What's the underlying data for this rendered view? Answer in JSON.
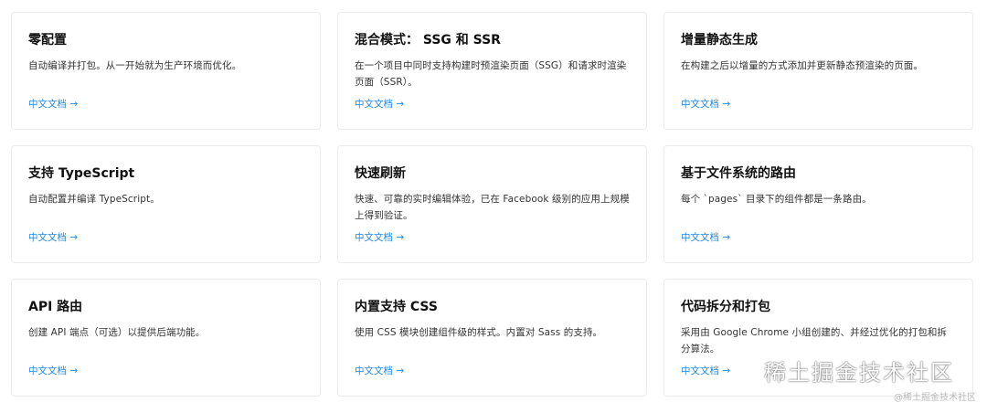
{
  "cards": [
    {
      "title": "零配置",
      "desc": "自动编译并打包。从一开始就为生产环境而优化。",
      "link": "中文文档 →"
    },
    {
      "title": "混合模式： SSG 和 SSR",
      "desc": "在一个项目中同时支持构建时预渲染页面（SSG）和请求时渲染页面（SSR）。",
      "link": "中文文档 →"
    },
    {
      "title": "增量静态生成",
      "desc": "在构建之后以增量的方式添加并更新静态预渲染的页面。",
      "link": "中文文档 →"
    },
    {
      "title": "支持 TypeScript",
      "desc": "自动配置并编译 TypeScript。",
      "link": "中文文档 →"
    },
    {
      "title": "快速刷新",
      "desc": "快速、可靠的实时编辑体验，已在 Facebook 级别的应用上规模上得到验证。",
      "link": "中文文档 →"
    },
    {
      "title": "基于文件系统的路由",
      "desc": "每个 `pages` 目录下的组件都是一条路由。",
      "link": "中文文档 →"
    },
    {
      "title": "API 路由",
      "desc": "创建 API 端点（可选）以提供后端功能。",
      "link": "中文文档 →"
    },
    {
      "title": "内置支持 CSS",
      "desc": "使用 CSS 模块创建组件级的样式。内置对 Sass 的支持。",
      "link": "中文文档 →"
    },
    {
      "title": "代码拆分和打包",
      "desc": "采用由 Google Chrome 小组创建的、并经过优化的打包和拆分算法。",
      "link": "中文文档 →"
    }
  ],
  "watermark": {
    "text": "稀土掘金技术社区",
    "small": "@稀土掘金技术社区",
    "icon": "wechat-icon"
  },
  "colors": {
    "link": "#1e88e5",
    "border": "#ececec",
    "title": "#111111"
  }
}
